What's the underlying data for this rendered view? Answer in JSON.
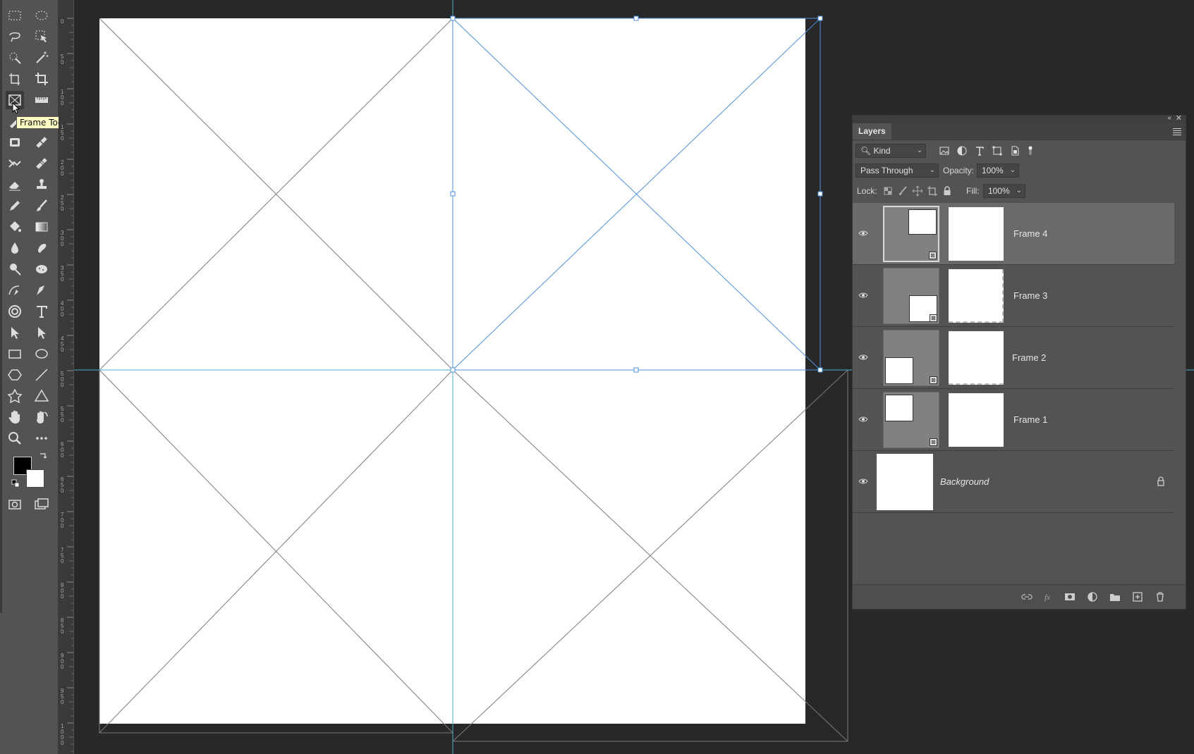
{
  "tooltip": {
    "text": "Frame Tool"
  },
  "tools": [
    "rectangular-marquee-icon",
    "elliptical-marquee-icon",
    "lasso-icon",
    "object-selection-icon",
    "quick-selection-icon",
    "magic-wand-icon",
    "perspective-crop-icon",
    "crop-icon",
    "frame-tool-icon",
    "ruler-icon",
    "eyedropper-icon",
    "spot-healing-icon",
    "content-aware-move-icon",
    "healing-brush-icon",
    "eraser-icon",
    "clone-stamp-icon",
    "pencil-icon",
    "brush-icon",
    "paint-bucket-icon",
    "gradient-icon",
    "blur-icon",
    "smudge-icon",
    "dodge-icon",
    "sponge-icon",
    "curvature-pen-icon",
    "pen-icon",
    "puppet-warp-icon",
    "type-icon",
    "path-selection-icon",
    "direct-selection-icon",
    "rectangle-icon",
    "ellipse-icon",
    "polygon-icon",
    "line-icon",
    "custom-shape-icon",
    "triangle-icon",
    "hand-icon",
    "rotate-view-icon",
    "zoom-icon",
    "more-tools-icon"
  ],
  "ruler": {
    "labels": [
      "0",
      "50",
      "100",
      "150",
      "200",
      "250",
      "300",
      "350",
      "400",
      "450",
      "500",
      "550",
      "600",
      "650",
      "700",
      "750",
      "800",
      "850",
      "900",
      "950",
      "1000"
    ]
  },
  "layers_panel": {
    "tab": "Layers",
    "filter": {
      "kind": "Kind"
    },
    "blend_mode": "Pass Through",
    "opacity_label": "Opacity:",
    "opacity_value": "100%",
    "lock_label": "Lock:",
    "fill_label": "Fill:",
    "fill_value": "100%",
    "layers": [
      {
        "name": "Frame 4",
        "selected": true
      },
      {
        "name": "Frame 3",
        "selected": false
      },
      {
        "name": "Frame 2",
        "selected": false
      },
      {
        "name": "Frame 1",
        "selected": false
      },
      {
        "name": "Background",
        "selected": false,
        "locked": true
      }
    ]
  },
  "colors": {
    "foreground": "#000000",
    "background": "#ffffff",
    "selection": "#4a90d9"
  }
}
